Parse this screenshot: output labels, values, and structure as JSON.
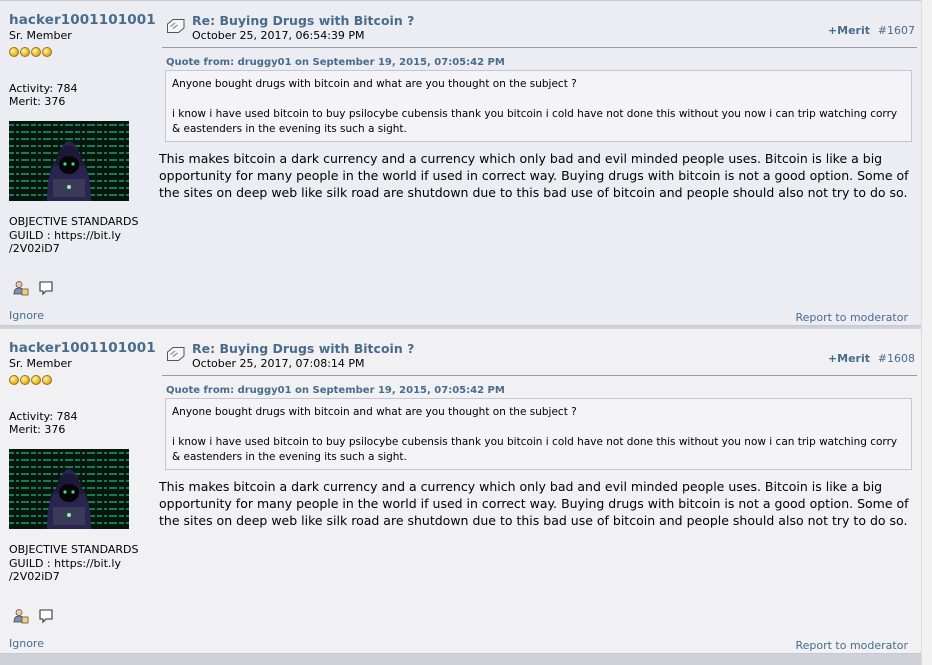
{
  "posts": [
    {
      "username": "hacker1001101001",
      "rank": "Sr. Member",
      "activity": "Activity: 784",
      "merit_stat": "Merit: 376",
      "signature": "OBJECTIVE STANDARDS GUILD : https://bit.ly /2V02iD7",
      "ignore": "Ignore",
      "subject": "Re: Buying Drugs with Bitcoin ?",
      "date": "October 25, 2017, 06:54:39 PM",
      "merit_button": "+Merit",
      "message_number": "#1607",
      "quote_header": "Quote from: druggy01 on September 19, 2015, 07:05:42 PM",
      "quote_line1": "Anyone bought drugs with bitcoin and what are you thought on the subject ?",
      "quote_line2": "i know i have used bitcoin to buy psilocybe cubensis thank you bitcoin i cold have not done this without you now i can trip watching corry & eastenders in the evening its such a sight.",
      "body": "This makes bitcoin a dark currency and a currency which only bad and evil minded people uses. Bitcoin is like a big opportunity for many people in the world if used in correct way. Buying drugs with bitcoin is not a good option. Some of the sites on deep web like silk road are shutdown due to this bad use of bitcoin and people should also not try to do so.",
      "report": "Report to moderator"
    },
    {
      "username": "hacker1001101001",
      "rank": "Sr. Member",
      "activity": "Activity: 784",
      "merit_stat": "Merit: 376",
      "signature": "OBJECTIVE STANDARDS GUILD : https://bit.ly /2V02iD7",
      "ignore": "Ignore",
      "subject": "Re: Buying Drugs with Bitcoin ?",
      "date": "October 25, 2017, 07:08:14 PM",
      "merit_button": "+Merit",
      "message_number": "#1608",
      "quote_header": "Quote from: druggy01 on September 19, 2015, 07:05:42 PM",
      "quote_line1": "Anyone bought drugs with bitcoin and what are you thought on the subject ?",
      "quote_line2": "i know i have used bitcoin to buy psilocybe cubensis thank you bitcoin i cold have not done this without you now i can trip watching corry & eastenders in the evening its such a sight.",
      "body": "This makes bitcoin a dark currency and a currency which only bad and evil minded people uses. Bitcoin is like a big opportunity for many people in the world if used in correct way. Buying drugs with bitcoin is not a good option. Some of the sites on deep web like silk road are shutdown due to this bad use of bitcoin and people should also not try to do so.",
      "report": "Report to moderator"
    }
  ],
  "icons": {
    "topic": "topic-icon",
    "profile": "profile-icon",
    "personal_message": "personal-message-icon",
    "rank_star": "rank-star-icon"
  },
  "colors": {
    "link": "#476c8e",
    "post_bg_1": "#ecedf3",
    "post_bg_2": "#f1f1f3",
    "quote_bg": "#f3f3f8"
  }
}
